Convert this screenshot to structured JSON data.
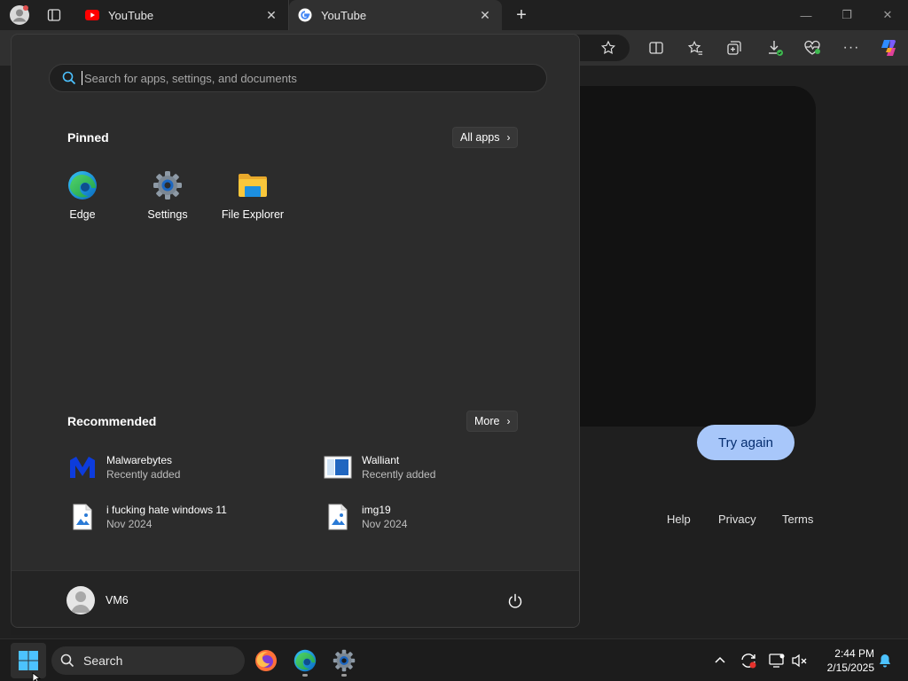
{
  "tabs": [
    {
      "title": "YouTube",
      "favicon": "youtube-icon",
      "active": false
    },
    {
      "title": "YouTube",
      "favicon": "google-icon",
      "active": true
    }
  ],
  "page": {
    "button": "Try again",
    "footer_links": [
      "Help",
      "Privacy",
      "Terms"
    ],
    "button_color": "#a8c7fa"
  },
  "start_menu": {
    "search_placeholder": "Search for apps, settings, and documents",
    "pinned_title": "Pinned",
    "all_apps_label": "All apps",
    "pinned": [
      {
        "label": "Edge",
        "icon": "edge-icon"
      },
      {
        "label": "Settings",
        "icon": "settings-gear-icon"
      },
      {
        "label": "File Explorer",
        "icon": "folder-icon"
      }
    ],
    "recommended_title": "Recommended",
    "more_label": "More",
    "recommended": [
      {
        "name": "Malwarebytes",
        "sub": "Recently added",
        "icon": "malwarebytes-icon"
      },
      {
        "name": "Walliant",
        "sub": "Recently added",
        "icon": "walliant-icon"
      },
      {
        "name": "i fucking hate windows 11",
        "sub": "Nov 2024",
        "icon": "image-file-icon"
      },
      {
        "name": "img19",
        "sub": "Nov 2024",
        "icon": "image-file-icon"
      }
    ],
    "user_name": "VM6"
  },
  "taskbar": {
    "search_label": "Search",
    "time": "2:44 PM",
    "date": "2/15/2025",
    "apps": [
      "firefox-icon",
      "edge-icon",
      "settings-gear-icon"
    ]
  }
}
